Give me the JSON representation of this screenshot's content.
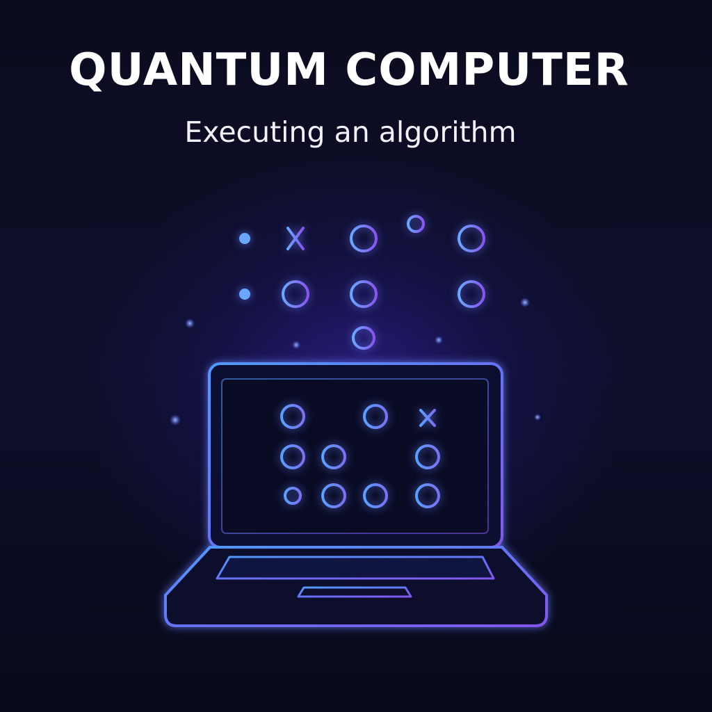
{
  "title": "QUANTUM COMPUTER",
  "subtitle": "Executing an algorithm",
  "colors": {
    "background": "#0a0b1e",
    "glow_center": "#3e28be",
    "circuit_blue": "#6aa8ff",
    "circuit_purple": "#8a52f0",
    "laptop_outline": "#5b8dff",
    "text": "#ffffff"
  },
  "illustration": {
    "floating_circuit": "quantum-circuit-icon",
    "device": "laptop-icon",
    "screen_circuit": "quantum-circuit-icon",
    "particles": "star-dot-icon"
  }
}
